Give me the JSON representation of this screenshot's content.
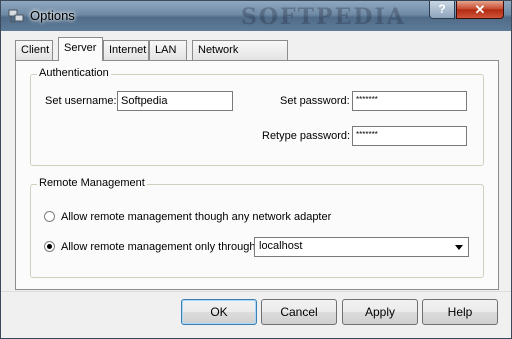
{
  "window": {
    "title": "Options",
    "watermark": "SOFTPEDIA",
    "help_glyph": "?",
    "close_glyph": "✕"
  },
  "tabs": [
    "Client",
    "Server",
    "Internet",
    "LAN",
    "Network Adapters"
  ],
  "authentication": {
    "group_label": "Authentication",
    "username_label": "Set username:",
    "username_value": "Softpedia",
    "password_label": "Set password:",
    "password_value": "*******",
    "retype_label": "Retype password:",
    "retype_value": "*******"
  },
  "remote": {
    "group_label": "Remote Management",
    "option_any": "Allow remote management though any network adapter",
    "option_only": "Allow remote management only through:",
    "selected_adapter": "localhost"
  },
  "buttons": {
    "ok": "OK",
    "cancel": "Cancel",
    "apply": "Apply",
    "help": "Help"
  }
}
